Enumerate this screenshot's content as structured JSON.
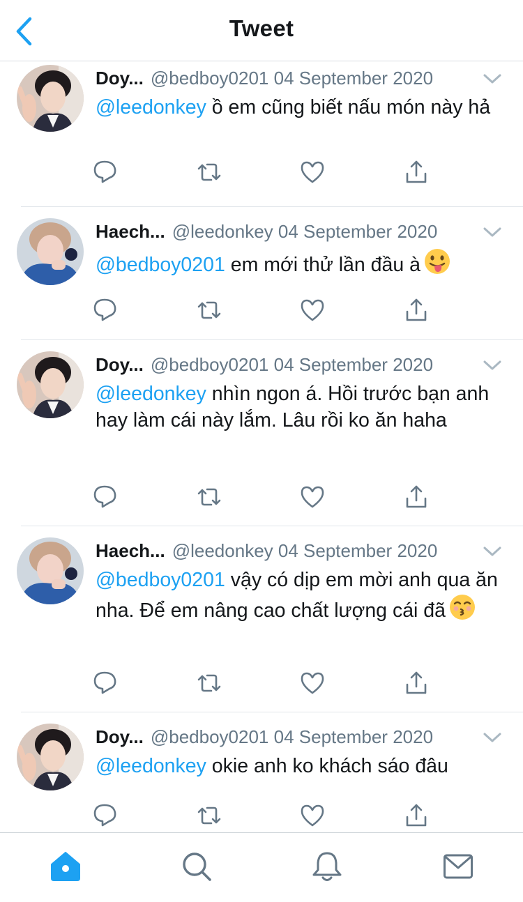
{
  "header": {
    "title": "Tweet",
    "back_icon": "chevron-left-icon"
  },
  "colors": {
    "accent": "#1da1f2",
    "text": "#14171a",
    "muted": "#657786",
    "icon": "#657786",
    "divider": "#e1e6ea"
  },
  "tweets": [
    {
      "name": "Doy...",
      "handle": "@bedboy0201",
      "date": "04 September 2020",
      "mention": "@leedonkey",
      "text": " ồ em cũng biết nấu món này hả",
      "emoji": ""
    },
    {
      "name": "Haech...",
      "handle": "@leedonkey",
      "date": "04 September 2020",
      "mention": "@bedboy0201",
      "text": " em mới thử lần đầu à",
      "emoji": "face-with-tongue"
    },
    {
      "name": "Doy...",
      "handle": "@bedboy0201",
      "date": "04 September 2020",
      "mention": "@leedonkey",
      "text": " nhìn ngon á. Hồi trước bạn anh hay làm cái này lắm. Lâu rồi ko ăn haha",
      "emoji": ""
    },
    {
      "name": "Haech...",
      "handle": "@leedonkey",
      "date": "04 September 2020",
      "mention": "@bedboy0201",
      "text": " vậy có dịp em mời anh qua ăn nha. Để em nâng cao chất lượng cái đã",
      "emoji": "kissing-face"
    },
    {
      "name": "Doy...",
      "handle": "@bedboy0201",
      "date": "04 September 2020",
      "mention": "@leedonkey",
      "text": " okie anh ko khách sáo đâu",
      "emoji": ""
    }
  ],
  "actions": [
    "reply-icon",
    "retweet-icon",
    "like-icon",
    "share-icon"
  ],
  "tabbar": {
    "items": [
      {
        "icon": "home-icon",
        "active": true
      },
      {
        "icon": "search-icon",
        "active": false
      },
      {
        "icon": "bell-icon",
        "active": false
      },
      {
        "icon": "mail-icon",
        "active": false
      }
    ]
  }
}
